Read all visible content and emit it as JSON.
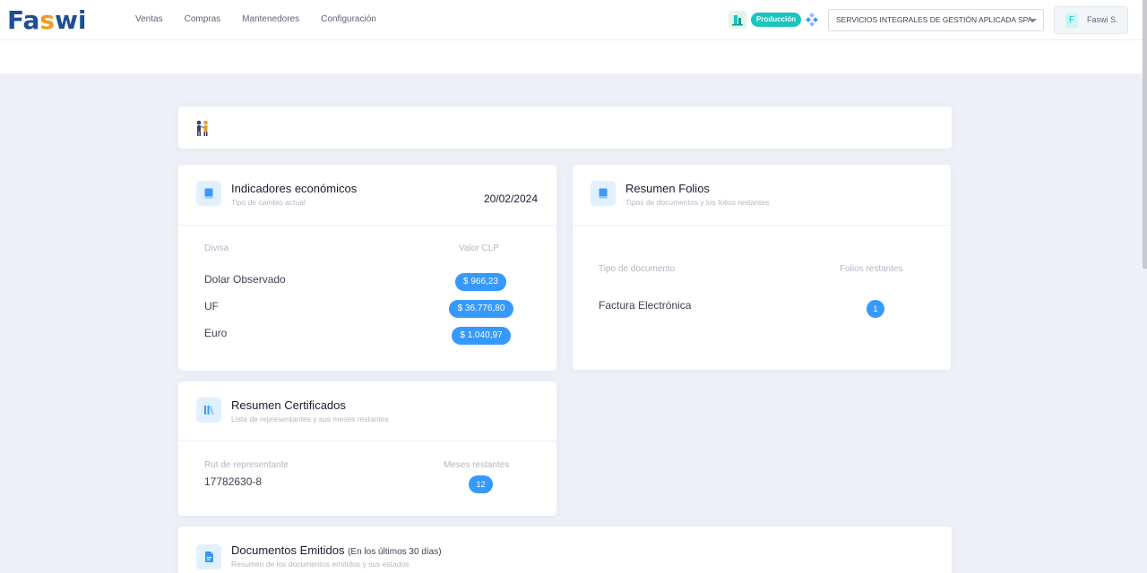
{
  "logo": {
    "part1": "Fa",
    "part2": "s",
    "part3": "wi"
  },
  "nav": [
    "Ventas",
    "Compras",
    "Mantenedores",
    "Configuración"
  ],
  "env": {
    "badge": "Producción",
    "color": "#1bc5bd"
  },
  "company": {
    "selected": "SERVICIOS INTEGRALES DE GESTIÓN APLICADA SPA"
  },
  "user": {
    "initial": "F",
    "name": "Faswi S."
  },
  "indicadores": {
    "title": "Indicadores económicos",
    "subtitle": "Tipo de cambio actual",
    "date": "20/02/2024",
    "col_divisa": "Divisa",
    "col_valor": "Valor CLP",
    "rows": [
      {
        "name": "Dolar Observado",
        "value": "$ 966,23"
      },
      {
        "name": "UF",
        "value": "$ 36.776,80"
      },
      {
        "name": "Euro",
        "value": "$ 1.040,97"
      }
    ]
  },
  "folios": {
    "title": "Resumen Folios",
    "subtitle": "Tipos de documentos y los folios restantes",
    "col_tipo": "Tipo de documento",
    "col_restantes": "Folios restantes",
    "rows": [
      {
        "name": "Factura Electrónica",
        "value": "1"
      }
    ]
  },
  "certificados": {
    "title": "Resumen Certificados",
    "subtitle": "Lista de representantes y sus meses restantes",
    "col_rut": "Rut de representante",
    "col_meses": "Meses restantes",
    "rows": [
      {
        "rut": "17782630-8",
        "meses": "12"
      }
    ]
  },
  "documentos": {
    "title": "Documentos Emitidos",
    "title_note": "(En los últimos 30 días)",
    "subtitle": "Resumen de los documentos emitidos y sus estados"
  },
  "colors": {
    "primary": "#3699ff",
    "accent": "#f39b21",
    "brand": "#1e4f91",
    "background": "#eef0f8"
  }
}
